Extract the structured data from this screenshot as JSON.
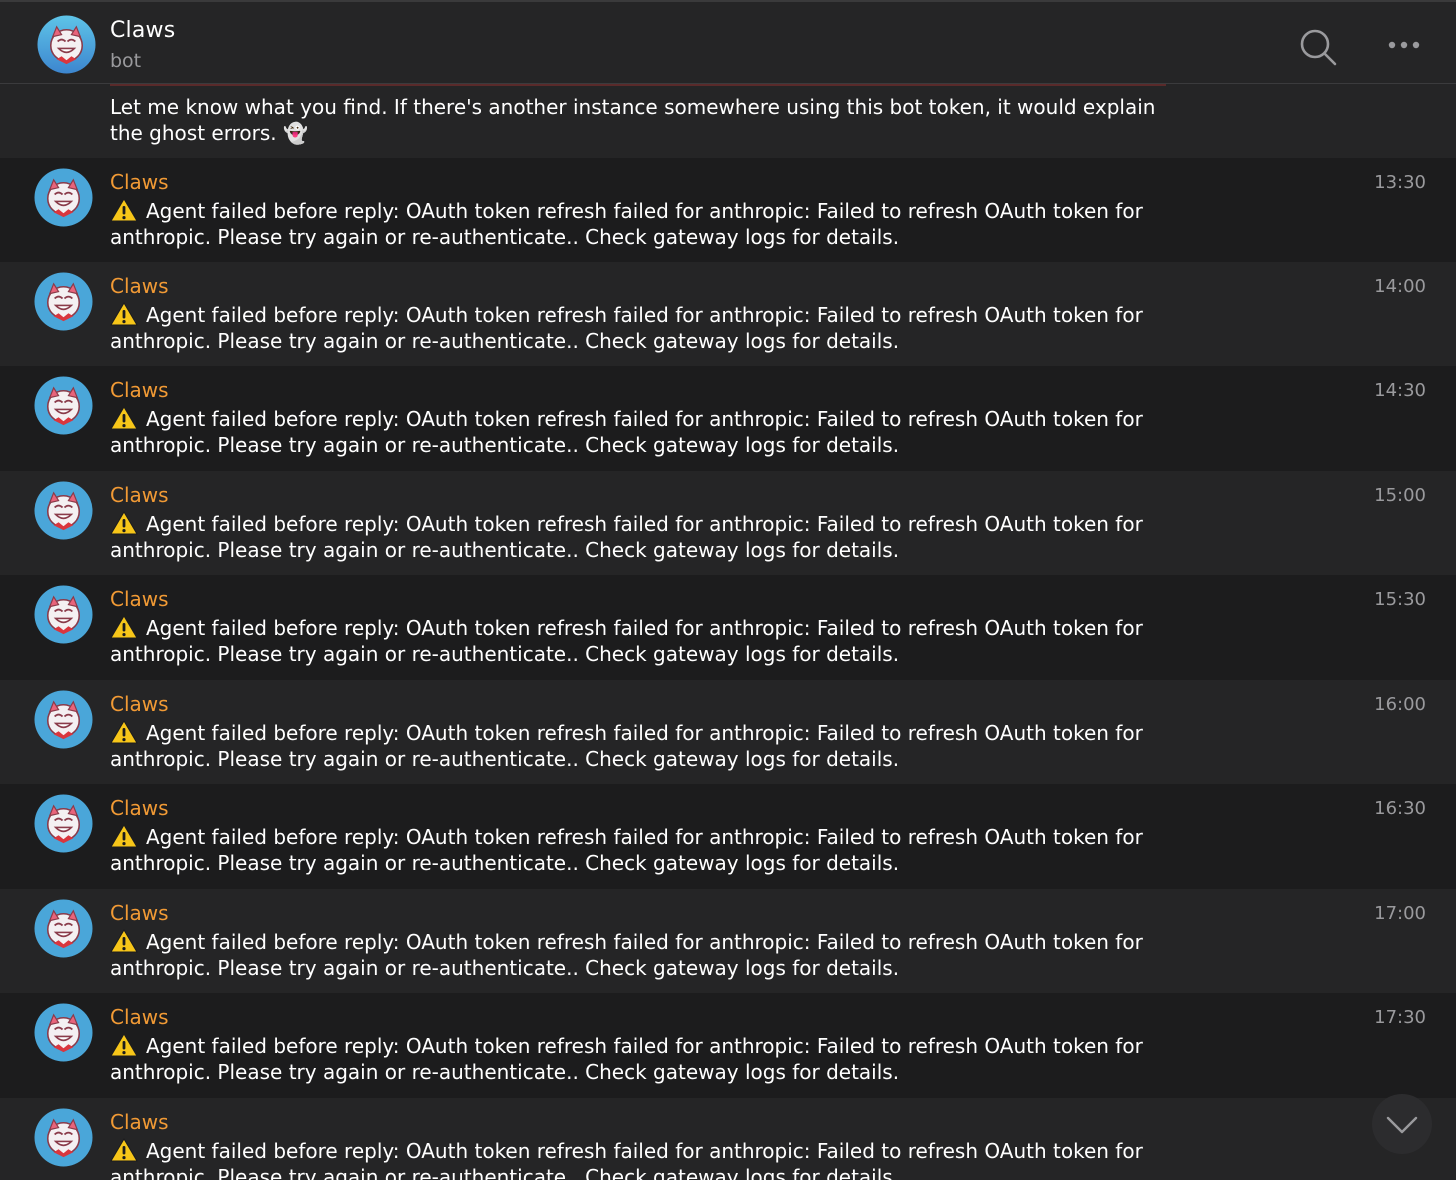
{
  "header": {
    "title": "Claws",
    "subtitle": "bot"
  },
  "previous_message": {
    "text": "Let me know what you find. If there's another instance somewhere using this bot token, it would explain the ghost errors. 👻"
  },
  "messages": [
    {
      "sender": "Claws",
      "time": "13:30",
      "text": "Agent failed before reply: OAuth token refresh failed for anthropic: Failed to refresh OAuth token for anthropic. Please try again or re-authenticate.. Check gateway logs for details."
    },
    {
      "sender": "Claws",
      "time": "14:00",
      "text": "Agent failed before reply: OAuth token refresh failed for anthropic: Failed to refresh OAuth token for anthropic. Please try again or re-authenticate.. Check gateway logs for details."
    },
    {
      "sender": "Claws",
      "time": "14:30",
      "text": "Agent failed before reply: OAuth token refresh failed for anthropic: Failed to refresh OAuth token for anthropic. Please try again or re-authenticate.. Check gateway logs for details."
    },
    {
      "sender": "Claws",
      "time": "15:00",
      "text": "Agent failed before reply: OAuth token refresh failed for anthropic: Failed to refresh OAuth token for anthropic. Please try again or re-authenticate.. Check gateway logs for details."
    },
    {
      "sender": "Claws",
      "time": "15:30",
      "text": "Agent failed before reply: OAuth token refresh failed for anthropic: Failed to refresh OAuth token for anthropic. Please try again or re-authenticate.. Check gateway logs for details."
    },
    {
      "sender": "Claws",
      "time": "16:00",
      "text": "Agent failed before reply: OAuth token refresh failed for anthropic: Failed to refresh OAuth token for anthropic. Please try again or re-authenticate.. Check gateway logs for details."
    },
    {
      "sender": "Claws",
      "time": "16:30",
      "text": "Agent failed before reply: OAuth token refresh failed for anthropic: Failed to refresh OAuth token for anthropic. Please try again or re-authenticate.. Check gateway logs for details."
    },
    {
      "sender": "Claws",
      "time": "17:00",
      "text": "Agent failed before reply: OAuth token refresh failed for anthropic: Failed to refresh OAuth token for anthropic. Please try again or re-authenticate.. Check gateway logs for details."
    },
    {
      "sender": "Claws",
      "time": "17:30",
      "text": "Agent failed before reply: OAuth token refresh failed for anthropic: Failed to refresh OAuth token for anthropic. Please try again or re-authenticate.. Check gateway logs for details."
    },
    {
      "sender": "Claws",
      "time": "",
      "text": "Agent failed before reply: OAuth token refresh failed for anthropic: Failed to refresh OAuth token for anthropic. Please try again or re-authenticate.. Check gateway logs for details."
    }
  ],
  "icons": {
    "avatar": "bot-avatar-icon",
    "search": "search-icon",
    "more": "more-dots-icon",
    "warning": "warning-icon",
    "scroll_down": "chevron-down-icon"
  },
  "colors": {
    "sender_name": "#f19a35",
    "background": "#1c1c1d",
    "alt_row": "#252526",
    "avatar_bg": "#4aa6d9"
  }
}
